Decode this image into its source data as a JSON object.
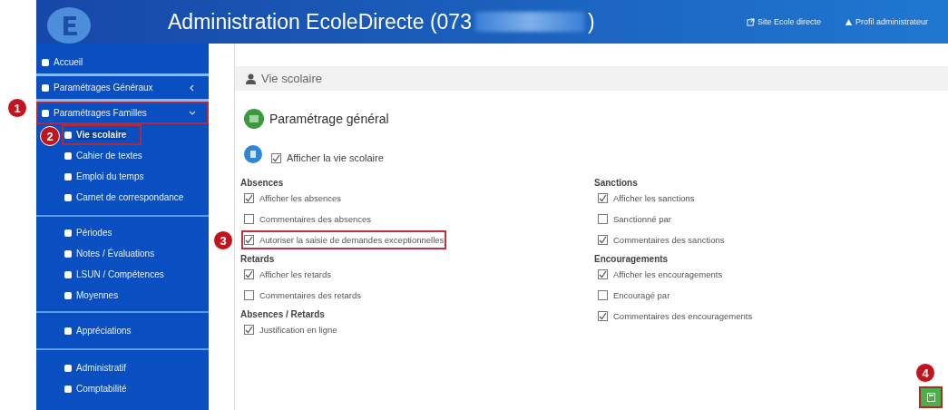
{
  "header": {
    "title": "Administration EcoleDirecte (073",
    "title_end": ")",
    "links": [
      "Site Ecole directe",
      "Profil administrateur"
    ]
  },
  "sidebar": {
    "groups": [
      {
        "items": [
          {
            "label": "Accueil",
            "kind": "top",
            "selected": false,
            "highlighted": false
          }
        ]
      },
      {
        "items": [
          {
            "label": "Paramétrages Généraux",
            "kind": "menu",
            "expanded": false,
            "selected": false,
            "highlighted": false
          }
        ]
      },
      {
        "items": [
          {
            "label": "Paramétrages Familles",
            "kind": "menu",
            "expanded": true,
            "selected": false,
            "highlighted": true,
            "callout": "1"
          },
          {
            "label": "Vie scolaire",
            "kind": "sub",
            "selected": true,
            "highlighted": true,
            "callout": "2"
          },
          {
            "label": "Cahier de textes",
            "kind": "sub",
            "selected": false,
            "highlighted": false
          },
          {
            "label": "Emploi du temps",
            "kind": "sub",
            "selected": false,
            "highlighted": false
          },
          {
            "label": "Carnet de correspondance",
            "kind": "sub",
            "selected": false,
            "highlighted": false
          }
        ]
      },
      {
        "items": [
          {
            "label": "Périodes",
            "kind": "sub",
            "selected": false,
            "highlighted": false
          },
          {
            "label": "Notes / Évaluations",
            "kind": "sub",
            "selected": false,
            "highlighted": false
          },
          {
            "label": "LSUN / Compétences",
            "kind": "sub",
            "selected": false,
            "highlighted": false
          },
          {
            "label": "Moyennes",
            "kind": "sub",
            "selected": false,
            "highlighted": false
          }
        ]
      },
      {
        "items": [
          {
            "label": "Appréciations",
            "kind": "sub",
            "selected": false,
            "highlighted": false
          }
        ]
      },
      {
        "items": [
          {
            "label": "Administratif",
            "kind": "sub",
            "selected": false,
            "highlighted": false
          },
          {
            "label": "Comptabilité",
            "kind": "sub",
            "selected": false,
            "highlighted": false
          }
        ]
      }
    ]
  },
  "panel": {
    "heading": "Vie scolaire",
    "section_title": "Paramétrage général",
    "master": {
      "label": "Afficher la vie scolaire",
      "checked": true
    },
    "columns": [
      {
        "groups": [
          {
            "title": "Absences",
            "options": [
              {
                "label": "Afficher les absences",
                "checked": true,
                "highlighted": false
              },
              {
                "label": "Commentaires des absences",
                "checked": false,
                "highlighted": false
              },
              {
                "label": "Autoriser la saisie de demandes exceptionnelles",
                "checked": true,
                "highlighted": true,
                "callout": "3"
              }
            ]
          },
          {
            "title": "Retards",
            "options": [
              {
                "label": "Afficher les retards",
                "checked": true,
                "highlighted": false
              },
              {
                "label": "Commentaires des retards",
                "checked": false,
                "highlighted": false
              }
            ]
          },
          {
            "title": "Absences / Retards",
            "options": [
              {
                "label": "Justification en ligne",
                "checked": true,
                "highlighted": false
              }
            ]
          }
        ]
      },
      {
        "groups": [
          {
            "title": "Sanctions",
            "options": [
              {
                "label": "Afficher les sanctions",
                "checked": true,
                "highlighted": false
              },
              {
                "label": "Sanctionné par",
                "checked": false,
                "highlighted": false
              },
              {
                "label": "Commentaires des sanctions",
                "checked": true,
                "highlighted": false
              }
            ]
          },
          {
            "title": "Encouragements",
            "options": [
              {
                "label": "Afficher les encouragements",
                "checked": true,
                "highlighted": false
              },
              {
                "label": "Encouragé par",
                "checked": false,
                "highlighted": false
              },
              {
                "label": "Commentaires des encouragements",
                "checked": true,
                "highlighted": false
              }
            ]
          }
        ]
      }
    ],
    "save": {
      "highlighted": true,
      "callout": "4"
    }
  }
}
